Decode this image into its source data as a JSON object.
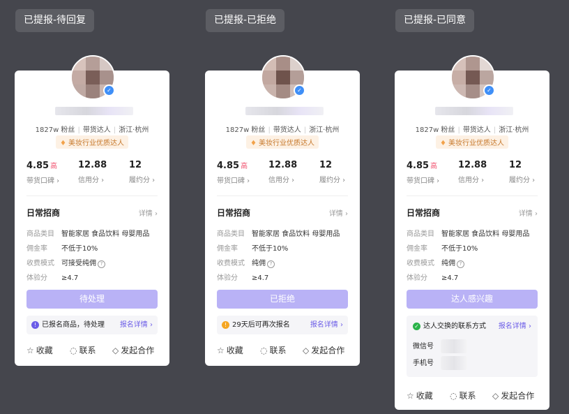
{
  "tags": [
    "已提报-待回复",
    "已提报-已拒绝",
    "已提报-已同意"
  ],
  "profile": {
    "fans": "1827w 粉丝",
    "role": "带货达人",
    "location": "浙江·杭州",
    "badge": "美妆行业优质达人"
  },
  "stats": {
    "koubei": "4.85",
    "koubei_level": "高",
    "koubei_label": "带货口碑",
    "credit": "12.88",
    "credit_label": "信用分",
    "perform": "12",
    "perform_label": "履约分"
  },
  "section": {
    "title": "日常招商",
    "more": "详情"
  },
  "fields": {
    "category_k": "商品类目",
    "category_v": "智能家居 食品饮料 母婴用品",
    "commission_k": "佣金率",
    "commission_v": "不低于10%",
    "mode_k": "收费模式",
    "exp_k": "体验分",
    "exp_v": "≥4.7"
  },
  "cards": [
    {
      "mode": "可接受纯佣",
      "button": "待处理",
      "notice_icon": "info-icon",
      "notice_color": "#6b5ce7",
      "notice": "已报名商品，待处理",
      "notice_link": "报名详情"
    },
    {
      "mode": "纯佣",
      "button": "已拒绝",
      "notice_icon": "warning-icon",
      "notice_color": "#f5a623",
      "notice": "29天后可再次报名",
      "notice_link": "报名详情"
    },
    {
      "mode": "纯佣",
      "button": "达人感兴趣",
      "notice_icon": "check-icon",
      "notice_color": "#2bb34a",
      "notice": "达人交换的联系方式",
      "notice_link": "报名详情",
      "wechat_label": "微信号",
      "phone_label": "手机号"
    }
  ],
  "actions": {
    "fav": "收藏",
    "contact": "联系",
    "coop": "发起合作"
  },
  "colors": {
    "accent": "#6b5ce7",
    "button_bg": "#b9b2f6",
    "page_bg": "#45464d"
  }
}
